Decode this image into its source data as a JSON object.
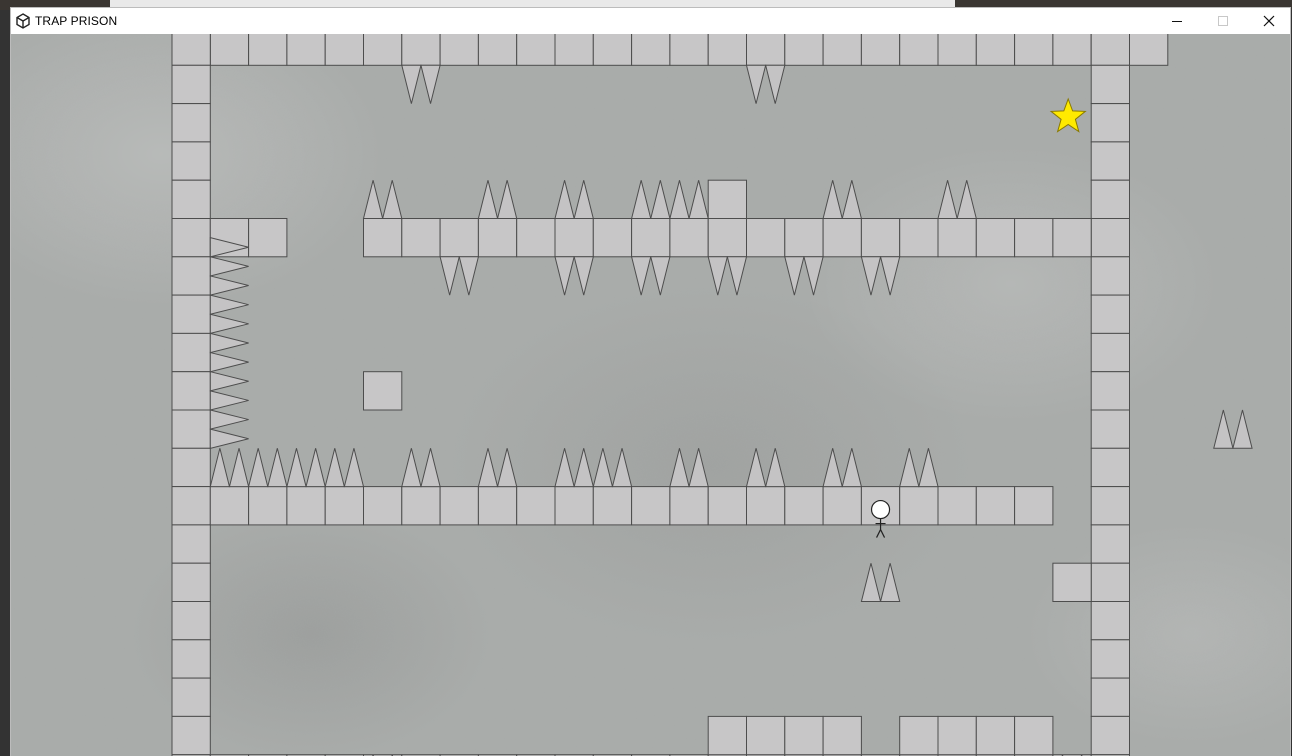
{
  "window": {
    "title": "TRAP PRISON",
    "controls": {
      "minimize": "minimize",
      "maximize": "maximize",
      "close": "close"
    }
  },
  "game": {
    "goal": "star",
    "player": "stick-figure",
    "tile_color": "#c7c6c7",
    "tile_border": "#4d4d4d",
    "spike_color": "#c4c3c4",
    "star_color": "#ffea00",
    "background": "concrete"
  }
}
